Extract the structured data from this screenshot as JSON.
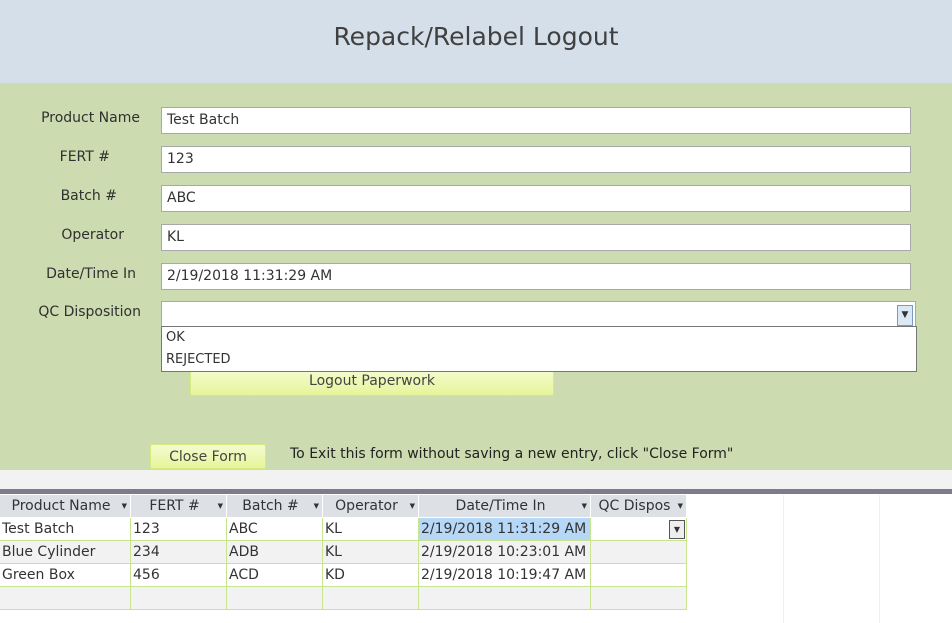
{
  "title": "Repack/Relabel Logout",
  "fields": [
    {
      "label": "Product Name",
      "value": "Test Batch"
    },
    {
      "label": "FERT #",
      "value": "123"
    },
    {
      "label": "Batch #",
      "value": "ABC"
    },
    {
      "label": "Operator",
      "value": "KL"
    },
    {
      "label": "Date/Time In",
      "value": "2/19/2018 11:31:29 AM"
    },
    {
      "label": "QC Disposition",
      "value": ""
    }
  ],
  "qc_options": [
    "OK",
    "REJECTED"
  ],
  "logout_button": "Logout Paperwork",
  "close_button": "Close Form",
  "close_note": "To Exit this form without saving a new entry, click \"Close Form\"",
  "table": {
    "columns": [
      "Product Name",
      "FERT #",
      "Batch #",
      "Operator",
      "Date/Time In",
      "QC Dispos"
    ],
    "rows": [
      [
        "Test Batch",
        "123",
        "ABC",
        "KL",
        "2/19/2018 11:31:29 AM",
        ""
      ],
      [
        "Blue Cylinder",
        "234",
        "ADB",
        "KL",
        "2/19/2018 10:23:01 AM",
        ""
      ],
      [
        "Green Box",
        "456",
        "ACD",
        "KD",
        "2/19/2018 10:19:47 AM",
        ""
      ]
    ]
  }
}
